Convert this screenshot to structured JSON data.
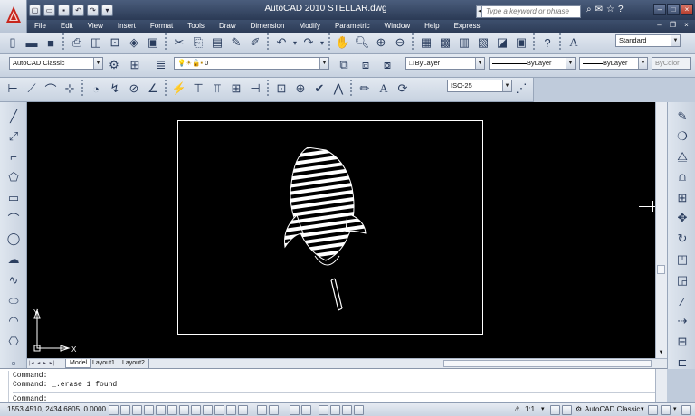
{
  "window": {
    "title": "AutoCAD 2010    STELLAR.dwg",
    "search_placeholder": "Type a keyword or phrase"
  },
  "menu": [
    "File",
    "Edit",
    "View",
    "Insert",
    "Format",
    "Tools",
    "Draw",
    "Dimension",
    "Modify",
    "Parametric",
    "Window",
    "Help",
    "Express"
  ],
  "toolbar": {
    "workspace": "AutoCAD Classic",
    "layer": "0",
    "text_style": "Standard",
    "dim_style": "ISO-25",
    "color": "ByLayer",
    "linetype": "ByLayer",
    "lineweight": "ByLayer",
    "plotstyle": "ByColor"
  },
  "layout_tabs": [
    "Model",
    "Layout1",
    "Layout2"
  ],
  "command_lines": [
    "Command:",
    "Command:  _.erase 1 found"
  ],
  "command_prompt": "Command:",
  "status": {
    "coordinates": "1553.4510, 2434.6805, 0.0000",
    "scale": "1:1",
    "workspace": "AutoCAD Classic"
  },
  "ucs": {
    "x_label": "X",
    "y_label": "Y"
  },
  "colors": {
    "title_bg": "#2b3a55",
    "canvas": "#000000",
    "toolbar": "#d6dee9"
  }
}
